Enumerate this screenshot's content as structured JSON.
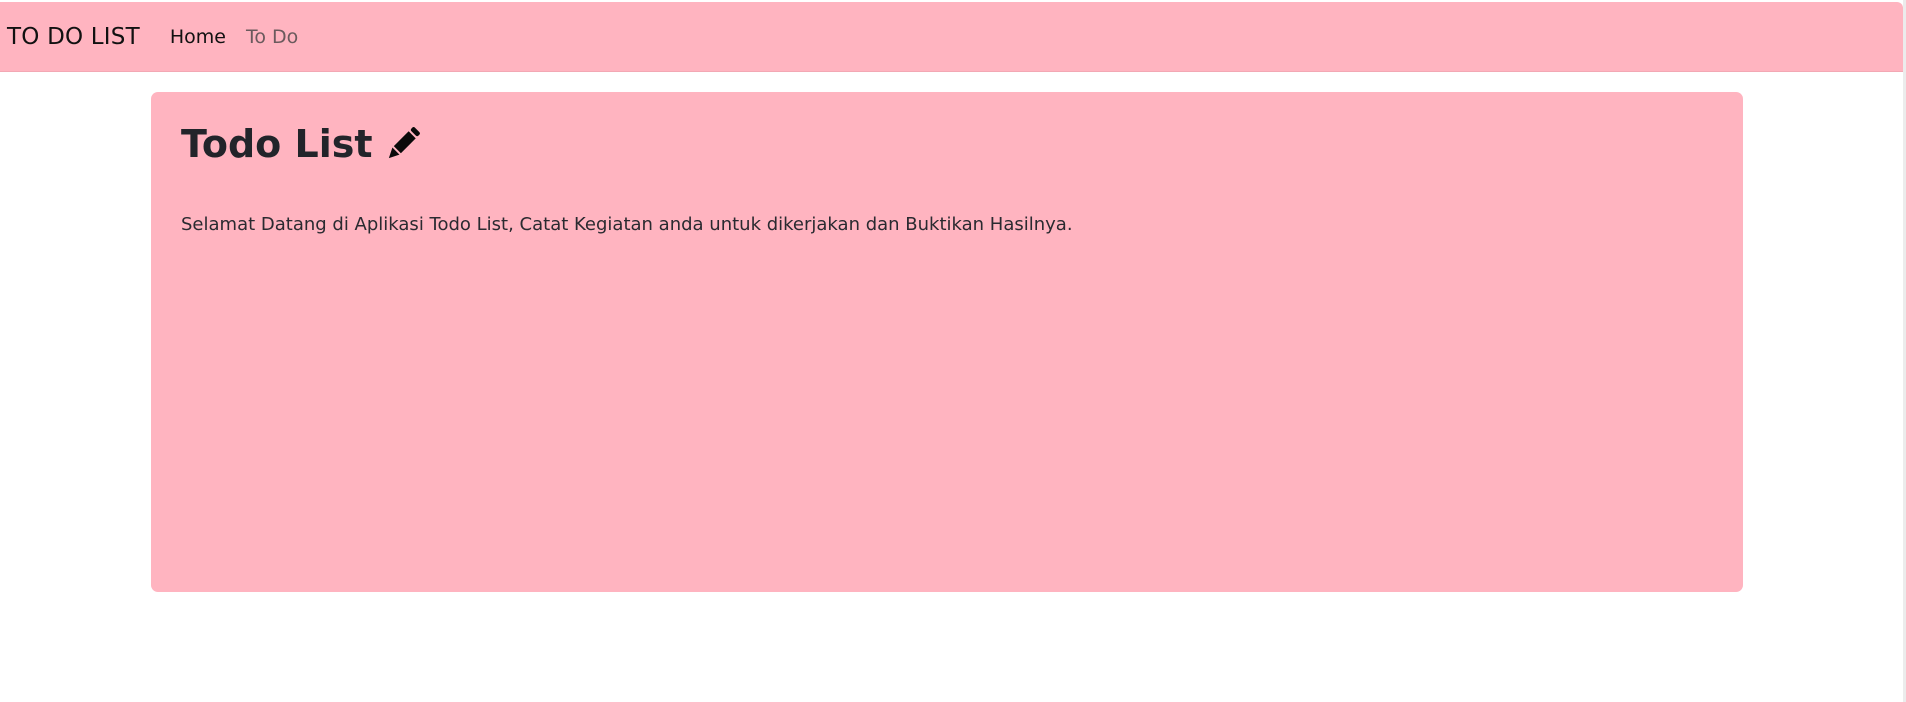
{
  "navbar": {
    "brand": "TO DO LIST",
    "links": [
      {
        "label": "Home",
        "state": "active"
      },
      {
        "label": "To Do",
        "state": "inactive"
      }
    ],
    "background": "#ffb4c0"
  },
  "main": {
    "title": "Todo List",
    "title_icon": "pencil-icon",
    "description": "Selamat Datang di Aplikasi Todo List, Catat Kegiatan anda untuk dikerjakan dan Buktikan Hasilnya.",
    "background": "#ffb4c0"
  }
}
